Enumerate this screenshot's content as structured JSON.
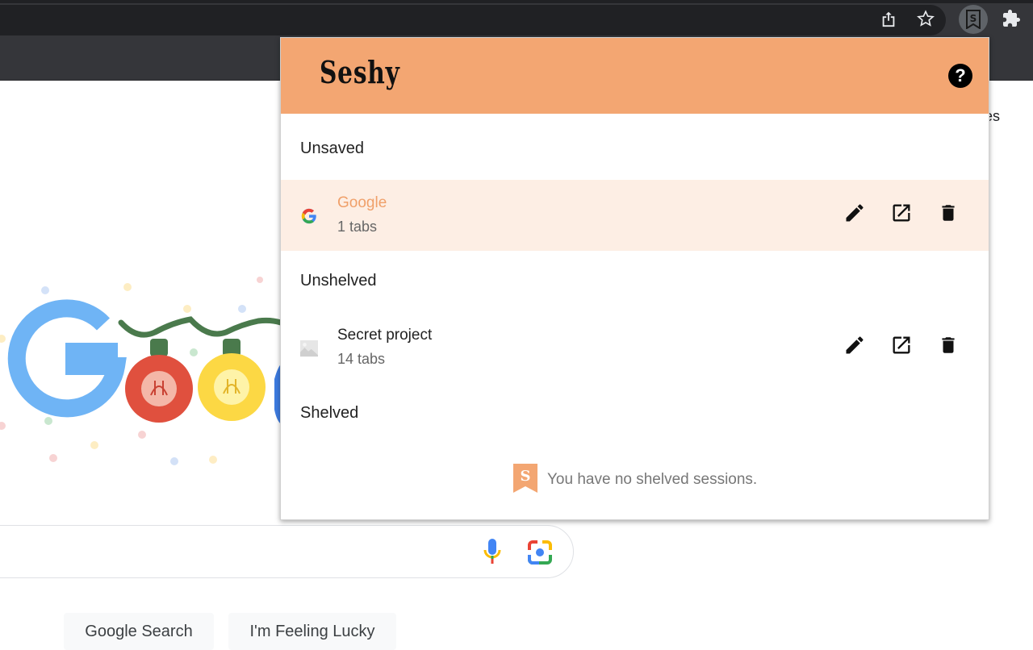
{
  "browser": {
    "toolbar_icons": [
      "share-icon",
      "star-icon",
      "seshy-extension-icon",
      "puzzle-icon"
    ]
  },
  "background_page": {
    "fragment_text": "es",
    "search_button": "Google Search",
    "lucky_button": "I'm Feeling Lucky"
  },
  "popup": {
    "brand": "Seshy",
    "help_label": "?",
    "accent": "#f3a672",
    "sections": {
      "unsaved": {
        "title": "Unsaved",
        "items": [
          {
            "title": "Google",
            "subtitle": "1 tabs",
            "icon": "google-favicon"
          }
        ]
      },
      "unshelved": {
        "title": "Unshelved",
        "items": [
          {
            "title": "Secret project",
            "subtitle": "14 tabs",
            "icon": "placeholder-image-icon"
          }
        ]
      },
      "shelved": {
        "title": "Shelved",
        "empty_message": "You have no shelved sessions."
      }
    }
  }
}
